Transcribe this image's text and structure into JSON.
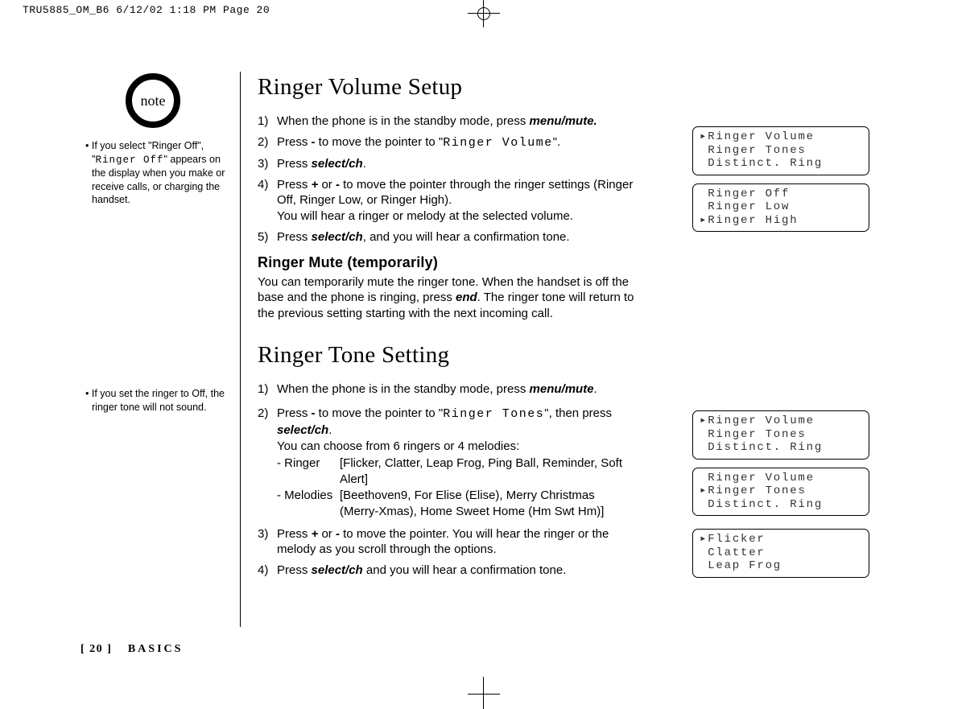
{
  "meta": {
    "crop_header": "TRU5885_OM_B6  6/12/02  1:18 PM  Page 20"
  },
  "sidebar": {
    "note_label": "note",
    "note1_prefix": "• If you select \"Ringer Off\", \"",
    "note1_lcd": "Ringer Off",
    "note1_suffix": "\" appears on the display when you make or receive calls, or charging the handset.",
    "note2": "• If you set the ringer to Off, the ringer tone will not sound."
  },
  "section1": {
    "title": "Ringer Volume Setup",
    "steps": {
      "s1_a": "When the phone is in the standby mode, press ",
      "s1_b": "menu/mute",
      "s1_c": ".",
      "s2_a": "Press ",
      "s2_b": "-",
      "s2_c": " to move the pointer to \"",
      "s2_lcd": "Ringer Volume",
      "s2_d": "\".",
      "s3_a": "Press ",
      "s3_b": "select/ch",
      "s3_c": ".",
      "s4_a": "Press ",
      "s4_b": "+",
      "s4_c": " or ",
      "s4_d": "-",
      "s4_e": " to move the pointer through the ringer settings (Ringer Off, Ringer Low, or Ringer High).",
      "s4_f": "You will hear a ringer or melody at the selected volume.",
      "s5_a": "Press ",
      "s5_b": "select/ch",
      "s5_c": ", and you will hear a confirmation tone."
    },
    "subhead": "Ringer Mute (temporarily)",
    "para_a": "You can temporarily mute the ringer tone. When the handset is off the base and the phone is ringing, press ",
    "para_b": "end",
    "para_c": ". The ringer tone will return to the previous setting starting with the next incoming call."
  },
  "section2": {
    "title": "Ringer Tone Setting",
    "steps": {
      "s1_a": "When the phone is in the standby mode, press ",
      "s1_b": "menu/mute",
      "s1_c": ".",
      "s2_a": "Press ",
      "s2_b": "-",
      "s2_c": " to move the pointer to \"",
      "s2_lcd": "Ringer Tones",
      "s2_d": "\", then press ",
      "s2_e": "select/ch",
      "s2_f": ".",
      "s2_g": "You can choose from 6 ringers or 4 melodies:",
      "r_label": "- Ringer",
      "r_val": "[Flicker, Clatter, Leap Frog, Ping Ball, Reminder, Soft Alert]",
      "m_label": "- Melodies",
      "m_val": "[Beethoven9, For Elise (Elise), Merry Christmas (Merry-Xmas), Home Sweet Home (Hm Swt Hm)]",
      "s3_a": "Press ",
      "s3_b": "+",
      "s3_c": " or ",
      "s3_d": "-",
      "s3_e": " to move the pointer. You will hear the ringer or the melody as you scroll through the options.",
      "s4_a": "Press ",
      "s4_b": "select/ch",
      "s4_c": " and you will hear a confirmation tone."
    }
  },
  "lcd": {
    "box1": "▸Ringer Volume\n Ringer Tones\n Distinct. Ring",
    "box2": " Ringer Off\n Ringer Low\n▸Ringer High",
    "box3": "▸Ringer Volume\n Ringer Tones\n Distinct. Ring",
    "box4": " Ringer Volume\n▸Ringer Tones\n Distinct. Ring",
    "box5": "▸Flicker\n Clatter\n Leap Frog"
  },
  "footer": {
    "page": "[ 20 ]",
    "section": "BASICS"
  }
}
